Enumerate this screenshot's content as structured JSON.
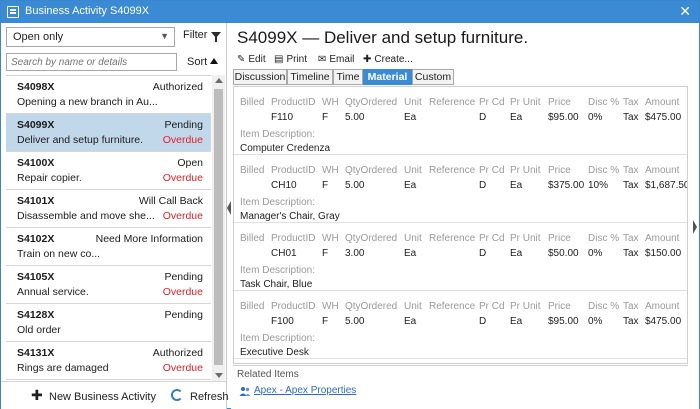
{
  "window": {
    "title": "Business Activity S4099X",
    "close_glyph": "✕"
  },
  "left": {
    "filter": {
      "value": "Open only",
      "button_label": "Filter"
    },
    "search": {
      "placeholder": "Search by name or details"
    },
    "sort": {
      "label": "Sort"
    },
    "items": [
      {
        "id": "S4098X",
        "status": "Authorized",
        "desc": "Opening a new branch in Au...",
        "overdue": ""
      },
      {
        "id": "S4099X",
        "status": "Pending",
        "desc": "Deliver and setup furniture.",
        "overdue": "Overdue"
      },
      {
        "id": "S4100X",
        "status": "Open",
        "desc": "Repair copier.",
        "overdue": "Overdue"
      },
      {
        "id": "S4101X",
        "status": "Will Call Back",
        "desc": "Disassemble and move she...",
        "overdue": "Overdue"
      },
      {
        "id": "S4102X",
        "status": "Need More Information",
        "desc": "Train on new co...",
        "overdue": ""
      },
      {
        "id": "S4105X",
        "status": "Pending",
        "desc": "Annual service.",
        "overdue": "Overdue"
      },
      {
        "id": "S4128X",
        "status": "Pending",
        "desc": "Old order",
        "overdue": ""
      },
      {
        "id": "S4131X",
        "status": "Authorized",
        "desc": "Rings are damaged",
        "overdue": "Overdue"
      }
    ],
    "footer": {
      "new_label": "New Business Activity",
      "refresh_label": "Refresh"
    }
  },
  "detail": {
    "heading": "S4099X — Deliver and setup furniture.",
    "toolbar": {
      "edit": "Edit",
      "print": "Print",
      "email": "Email",
      "create": "Create..."
    },
    "tabs": [
      "Discussion",
      "Timeline",
      "Time",
      "Material",
      "Custom"
    ],
    "active_tab": "Material",
    "columns": [
      "Billed",
      "ProductID",
      "WH",
      "QtyOrdered",
      "Unit",
      "Reference",
      "Pr Cd",
      "Pr Unit",
      "Price",
      "Disc %",
      "Tax",
      "Amount"
    ],
    "item_desc_label": "Item Description:",
    "lines": [
      {
        "product": "F110",
        "wh": "F",
        "qty": "5.00",
        "unit": "Ea",
        "reference": "",
        "prcd": "D",
        "prunit": "Ea",
        "price": "$95.00",
        "disc": "0%",
        "tax": "Tax",
        "amount": "$475.00",
        "description": "Computer Credenza"
      },
      {
        "product": "CH10",
        "wh": "F",
        "qty": "5.00",
        "unit": "Ea",
        "reference": "",
        "prcd": "D",
        "prunit": "Ea",
        "price": "$375.00",
        "disc": "10%",
        "tax": "Tax",
        "amount": "$1,687.50",
        "description": "Manager's Chair, Gray"
      },
      {
        "product": "CH01",
        "wh": "F",
        "qty": "3.00",
        "unit": "Ea",
        "reference": "",
        "prcd": "D",
        "prunit": "Ea",
        "price": "$50.00",
        "disc": "0%",
        "tax": "Tax",
        "amount": "$150.00",
        "description": "Task Chair, Blue"
      },
      {
        "product": "F100",
        "wh": "F",
        "qty": "5.00",
        "unit": "Ea",
        "reference": "",
        "prcd": "D",
        "prunit": "Ea",
        "price": "$95.00",
        "disc": "0%",
        "tax": "Tax",
        "amount": "$475.00",
        "description": "Executive Desk"
      }
    ],
    "related": {
      "title": "Related Items",
      "link": "Apex - Apex Properties"
    }
  },
  "colors": {
    "accent": "#3b8ad4",
    "selected_row": "#c1d7ea",
    "overdue": "#e81e25",
    "link": "#2a6cc0"
  }
}
